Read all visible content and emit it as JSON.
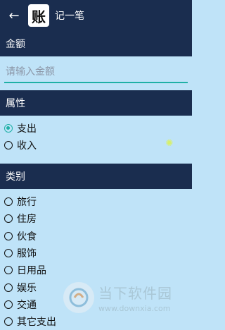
{
  "appbar": {
    "back_icon": "arrow-left-icon",
    "logo_char": "账",
    "title": "记一笔"
  },
  "amount": {
    "header": "金额",
    "placeholder": "请输入金额",
    "value": ""
  },
  "attribute": {
    "header": "属性",
    "options": [
      {
        "label": "支出",
        "checked": true
      },
      {
        "label": "收入",
        "checked": false
      }
    ]
  },
  "category": {
    "header": "类别",
    "options": [
      {
        "label": "旅行",
        "checked": false
      },
      {
        "label": "住房",
        "checked": false
      },
      {
        "label": "伙食",
        "checked": false
      },
      {
        "label": "服饰",
        "checked": false
      },
      {
        "label": "日用品",
        "checked": false
      },
      {
        "label": "娱乐",
        "checked": false
      },
      {
        "label": "交通",
        "checked": false
      },
      {
        "label": "其它支出",
        "checked": false
      }
    ]
  },
  "watermark": {
    "cn": "当下软件园",
    "en": "www.downxia.com"
  },
  "colors": {
    "bar": "#1a2d4f",
    "background": "#bfe3f8",
    "accent": "#1fb0a6"
  }
}
